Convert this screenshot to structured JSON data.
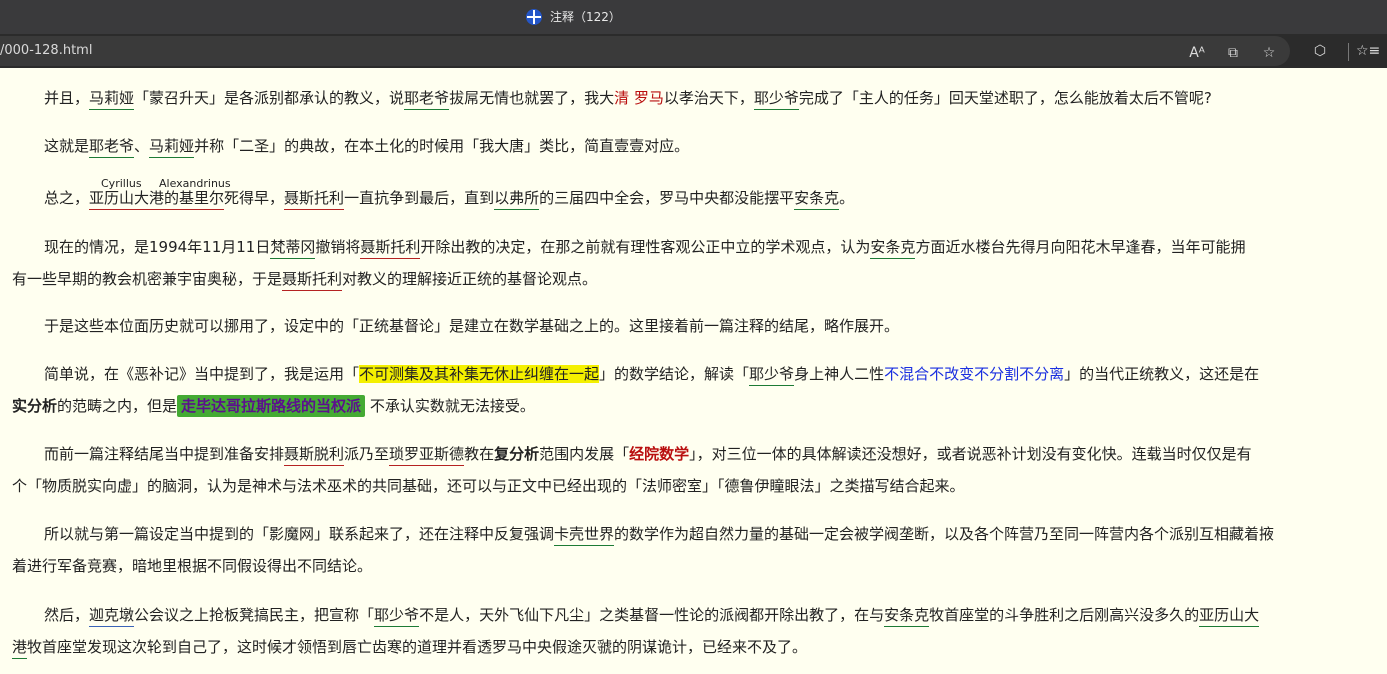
{
  "window": {
    "title": "注释（122）"
  },
  "browser": {
    "url": "/000-128.html",
    "tools": {
      "read_aloud_icon": "Aᴬ",
      "immersive_reader_icon": "⧉",
      "favorite_icon": "☆",
      "extensions_icon": "⬡",
      "favorites_bar_icon": "☆≡"
    }
  },
  "article": {
    "p1": {
      "a": "并且，",
      "b": "马莉娅",
      "c": "「蒙召升天」是各派别都承认的教义，说",
      "d": "耶老爷",
      "e": "拔屌无情也就罢了，我大",
      "f": "清",
      "g": "罗马",
      "h": "以孝治天下，",
      "i": "耶少爷",
      "j": "完成了「主人的任务」回天堂述职了，怎么能放着太后不管呢?"
    },
    "p2": {
      "a": "这就是",
      "b": "耶老爷",
      "c": "、",
      "d": "马莉娅",
      "e": "并称「二圣」的典故，在本土化的时候用「我大唐」类比，简直壹壹对应。"
    },
    "p3": {
      "anno1": "Cyrillus",
      "anno2": "Alexandrinus",
      "a": "总之，",
      "b": "亚历山大港的基里尔",
      "c": "死得早，",
      "d": "聂斯托利",
      "e": "一直抗争到最后，直到",
      "f": "以弗所",
      "g": "的三届四中全会，罗马中央都没能摆平",
      "h": "安条克",
      "i": "。"
    },
    "p4": {
      "a": "现在的情况，是1994年11月11日",
      "b": "梵蒂冈",
      "c": "撤销将",
      "d": "聂斯托利",
      "e": "开除出教的决定，在那之前就有理性客观公正中立的学术观点，认为",
      "f": "安条克",
      "g": "方面近水楼台先得月向阳花木早逢春，当年可能拥",
      "h": "有一些早期的教会机密兼宇宙奥秘，于是",
      "i": "聂斯托利",
      "j": "对教义的理解接近正统的基督论观点。"
    },
    "p5": {
      "a": "于是这些本位面历史就可以挪用了，设定中的「正统基督论」是建立在数学基础之上的。这里接着前一篇注释的结尾，略作展开。"
    },
    "p6": {
      "a": "简单说，在《恶补记》当中提到了，我是运用「",
      "b": "不可测集及其补集无休止纠缠在一起",
      "c": "」的数学结论，解读「",
      "d": "耶少爷",
      "e": "身上神人二性",
      "f": "不混合不改变不分割不分离",
      "g": "」的当代正统教义，这还是在",
      "h": "实分析",
      "i": "的范畴之内，但是",
      "j": "走毕达哥拉斯路线的当权派",
      "k": "不承认实数就无法接受。"
    },
    "p7": {
      "a": "而前一篇注释结尾当中提到准备安排",
      "b": "聂斯脱利",
      "c": "派乃至",
      "d": "琐罗亚斯德",
      "e": "教在",
      "f": "复分析",
      "g": "范围内发展「",
      "h": "经院数学",
      "i": "」，对三位一体的具体解读还没想好，或者说恶补计划没有变化快。连载当时仅仅是有",
      "j": "个「物质脱实向虚」的脑洞，认为是神术与法术巫术的共同基础，还可以与正文中已经出现的「法师密室」「德鲁伊瞳眼法」之类描写结合起来。"
    },
    "p8": {
      "a": "所以就与第一篇设定当中提到的「影魔网」联系起来了，还在注释中反复强调",
      "b": "卡壳世界",
      "c": "的数学作为超自然力量的基础一定会被学阀垄断，以及各个阵营乃至同一阵营内各个派别互相藏着掖",
      "d": "着进行军备竞赛，暗地里根据不同假设得出不同结论。"
    },
    "p9": {
      "a": "然后，",
      "b": "迦克墩",
      "c": "公会议之上抢板凳搞民主，把宣称「",
      "d": "耶少爷",
      "e": "不是人，天外飞仙下凡尘」之类基督一性论的派阀都开除出教了，在与",
      "f": "安条克",
      "g": "牧首座堂的斗争胜利之后刚高兴没多久的",
      "h": "亚历山大",
      "i": "港",
      "j": "牧首座堂发现这次轮到自己了，这时候才领悟到唇亡齿寒的道理并看透罗马中央假途灭虢的阴谋诡计，已经来不及了。"
    }
  }
}
